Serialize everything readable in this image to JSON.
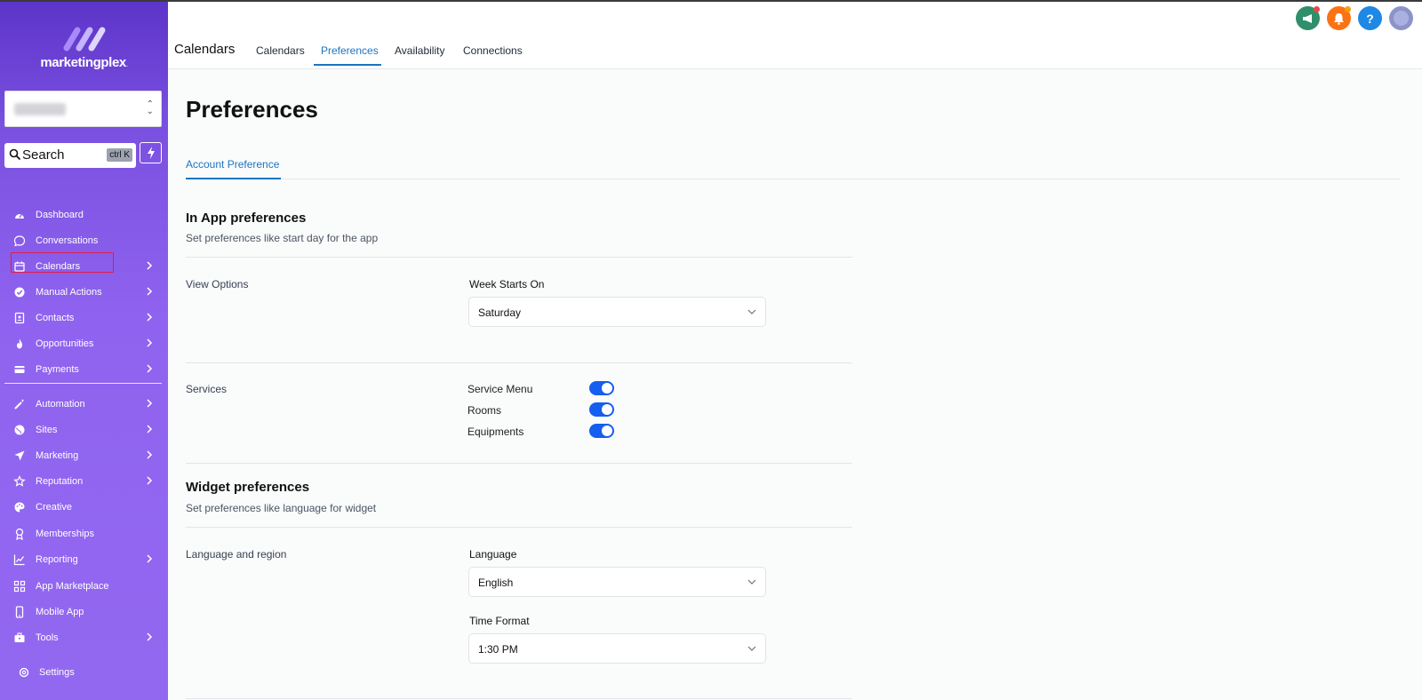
{
  "brand": {
    "name": "marketingplex",
    "suffix": "."
  },
  "account_select": {
    "value": ""
  },
  "search": {
    "label": "Search",
    "shortcut": "ctrl K"
  },
  "sidebar": {
    "items": [
      {
        "label": "Dashboard",
        "icon": "dashboard-icon",
        "chevron": false
      },
      {
        "label": "Conversations",
        "icon": "chat-bubble-icon",
        "chevron": false
      },
      {
        "label": "Calendars",
        "icon": "calendar-icon",
        "chevron": true
      },
      {
        "label": "Manual Actions",
        "icon": "check-circle-icon",
        "chevron": true
      },
      {
        "label": "Contacts",
        "icon": "contact-book-icon",
        "chevron": true
      },
      {
        "label": "Opportunities",
        "icon": "flame-icon",
        "chevron": true
      },
      {
        "label": "Payments",
        "icon": "credit-card-icon",
        "chevron": true
      },
      {
        "label": "Automation",
        "icon": "magic-wand-icon",
        "chevron": true
      },
      {
        "label": "Sites",
        "icon": "globe-icon",
        "chevron": true
      },
      {
        "label": "Marketing",
        "icon": "paper-plane-icon",
        "chevron": true
      },
      {
        "label": "Reputation",
        "icon": "star-icon",
        "chevron": true
      },
      {
        "label": "Creative",
        "icon": "palette-icon",
        "chevron": false
      },
      {
        "label": "Memberships",
        "icon": "award-icon",
        "chevron": false
      },
      {
        "label": "Reporting",
        "icon": "chart-icon",
        "chevron": true
      },
      {
        "label": "App Marketplace",
        "icon": "grid-icon",
        "chevron": false
      },
      {
        "label": "Mobile App",
        "icon": "phone-icon",
        "chevron": false
      },
      {
        "label": "Tools",
        "icon": "briefcase-icon",
        "chevron": true
      }
    ],
    "settings_label": "Settings"
  },
  "header": {
    "title": "Calendars",
    "tabs": [
      "Calendars",
      "Preferences",
      "Availability",
      "Connections"
    ],
    "active_tab": "Preferences"
  },
  "page": {
    "title": "Preferences",
    "subtab": "Account Preference"
  },
  "in_app": {
    "title": "In App preferences",
    "desc": "Set preferences like start day for the app",
    "view_options_label": "View Options",
    "week_starts_label": "Week Starts On",
    "week_starts_value": "Saturday",
    "services_label": "Services",
    "toggles": [
      {
        "label": "Service Menu",
        "on": true
      },
      {
        "label": "Rooms",
        "on": true
      },
      {
        "label": "Equipments",
        "on": true
      }
    ]
  },
  "widget": {
    "title": "Widget preferences",
    "desc": "Set preferences like language for widget",
    "region_label": "Language and region",
    "language_label": "Language",
    "language_value": "English",
    "time_format_label": "Time Format",
    "time_format_value": "1:30 PM"
  },
  "colors": {
    "sidebar_top": "#5c34c8",
    "sidebar_bottom": "#9368f0",
    "accent": "#1d74c3",
    "toggle_on": "#155eef",
    "highlight_outline": "#e11d48"
  }
}
